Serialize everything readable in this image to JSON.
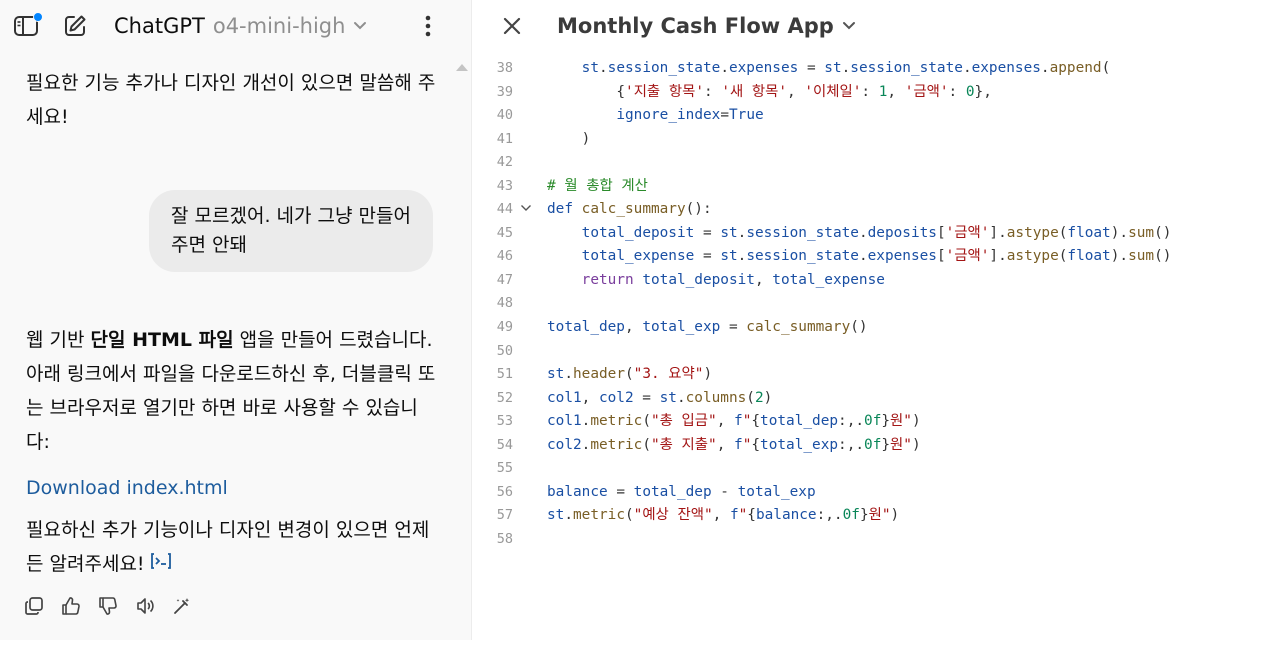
{
  "header": {
    "app_name": "ChatGPT",
    "model_name": "o4-mini-high"
  },
  "chat": {
    "msg1": "필요한 기능 추가나 디자인 개선이 있으면 말씀해 주세요!",
    "user_message": "잘 모르겠어. 네가 그냥 만들어 주면 안돼",
    "msg2_prefix": "웹 기반 ",
    "msg2_bold": "단일 HTML 파일",
    "msg2_suffix": " 앱을 만들어 드렸습니다. 아래 링크에서 파일을 다운로드하신 후, 더블클릭 또는 브라우저로 열기만 하면 바로 사용할 수 있습니다:",
    "download_link": "Download index.html",
    "msg3": "필요하신 추가 기능이나 디자인 변경이 있으면 언제든 알려주세요!"
  },
  "canvas": {
    "title": "Monthly Cash Flow App",
    "lines": [
      {
        "n": "38",
        "indent": 4,
        "fold": false,
        "tokens": [
          [
            "var",
            "st"
          ],
          [
            "p",
            "."
          ],
          [
            "var",
            "session_state"
          ],
          [
            "p",
            "."
          ],
          [
            "var",
            "expenses"
          ],
          [
            "p",
            " = "
          ],
          [
            "var",
            "st"
          ],
          [
            "p",
            "."
          ],
          [
            "var",
            "session_state"
          ],
          [
            "p",
            "."
          ],
          [
            "var",
            "expenses"
          ],
          [
            "p",
            "."
          ],
          [
            "fn",
            "append"
          ],
          [
            "p",
            "("
          ]
        ]
      },
      {
        "n": "39",
        "indent": 8,
        "fold": false,
        "tokens": [
          [
            "p",
            "{"
          ],
          [
            "str",
            "'지출 항목'"
          ],
          [
            "p",
            ": "
          ],
          [
            "str",
            "'새 항목'"
          ],
          [
            "p",
            ", "
          ],
          [
            "str",
            "'이체일'"
          ],
          [
            "p",
            ": "
          ],
          [
            "num",
            "1"
          ],
          [
            "p",
            ", "
          ],
          [
            "str",
            "'금액'"
          ],
          [
            "p",
            ": "
          ],
          [
            "num",
            "0"
          ],
          [
            "p",
            "},"
          ]
        ]
      },
      {
        "n": "40",
        "indent": 8,
        "fold": false,
        "tokens": [
          [
            "var",
            "ignore_index"
          ],
          [
            "p",
            "="
          ],
          [
            "def",
            "True"
          ]
        ]
      },
      {
        "n": "41",
        "indent": 4,
        "fold": false,
        "tokens": [
          [
            "p",
            ")"
          ]
        ]
      },
      {
        "n": "42",
        "indent": 0,
        "fold": false,
        "tokens": []
      },
      {
        "n": "43",
        "indent": 0,
        "fold": false,
        "tokens": [
          [
            "cm",
            "# 월 총합 계산"
          ]
        ]
      },
      {
        "n": "44",
        "indent": 0,
        "fold": true,
        "tokens": [
          [
            "def",
            "def"
          ],
          [
            "p",
            " "
          ],
          [
            "fn",
            "calc_summary"
          ],
          [
            "p",
            "():"
          ]
        ]
      },
      {
        "n": "45",
        "indent": 4,
        "fold": false,
        "tokens": [
          [
            "var",
            "total_deposit"
          ],
          [
            "p",
            " = "
          ],
          [
            "var",
            "st"
          ],
          [
            "p",
            "."
          ],
          [
            "var",
            "session_state"
          ],
          [
            "p",
            "."
          ],
          [
            "var",
            "deposits"
          ],
          [
            "p",
            "["
          ],
          [
            "str",
            "'금액'"
          ],
          [
            "p",
            "]."
          ],
          [
            "fn",
            "astype"
          ],
          [
            "p",
            "("
          ],
          [
            "var",
            "float"
          ],
          [
            "p",
            ")."
          ],
          [
            "fn",
            "sum"
          ],
          [
            "p",
            "()"
          ]
        ]
      },
      {
        "n": "46",
        "indent": 4,
        "fold": false,
        "tokens": [
          [
            "var",
            "total_expense"
          ],
          [
            "p",
            " = "
          ],
          [
            "var",
            "st"
          ],
          [
            "p",
            "."
          ],
          [
            "var",
            "session_state"
          ],
          [
            "p",
            "."
          ],
          [
            "var",
            "expenses"
          ],
          [
            "p",
            "["
          ],
          [
            "str",
            "'금액'"
          ],
          [
            "p",
            "]."
          ],
          [
            "fn",
            "astype"
          ],
          [
            "p",
            "("
          ],
          [
            "var",
            "float"
          ],
          [
            "p",
            ")."
          ],
          [
            "fn",
            "sum"
          ],
          [
            "p",
            "()"
          ]
        ]
      },
      {
        "n": "47",
        "indent": 4,
        "fold": false,
        "tokens": [
          [
            "kw",
            "return"
          ],
          [
            "p",
            " "
          ],
          [
            "var",
            "total_deposit"
          ],
          [
            "p",
            ", "
          ],
          [
            "var",
            "total_expense"
          ]
        ]
      },
      {
        "n": "48",
        "indent": 0,
        "fold": false,
        "tokens": []
      },
      {
        "n": "49",
        "indent": 0,
        "fold": false,
        "tokens": [
          [
            "var",
            "total_dep"
          ],
          [
            "p",
            ", "
          ],
          [
            "var",
            "total_exp"
          ],
          [
            "p",
            " = "
          ],
          [
            "fn",
            "calc_summary"
          ],
          [
            "p",
            "()"
          ]
        ]
      },
      {
        "n": "50",
        "indent": 0,
        "fold": false,
        "tokens": []
      },
      {
        "n": "51",
        "indent": 0,
        "fold": false,
        "tokens": [
          [
            "var",
            "st"
          ],
          [
            "p",
            "."
          ],
          [
            "fn",
            "header"
          ],
          [
            "p",
            "("
          ],
          [
            "str",
            "\"3. 요약\""
          ],
          [
            "p",
            ")"
          ]
        ]
      },
      {
        "n": "52",
        "indent": 0,
        "fold": false,
        "tokens": [
          [
            "var",
            "col1"
          ],
          [
            "p",
            ", "
          ],
          [
            "var",
            "col2"
          ],
          [
            "p",
            " = "
          ],
          [
            "var",
            "st"
          ],
          [
            "p",
            "."
          ],
          [
            "fn",
            "columns"
          ],
          [
            "p",
            "("
          ],
          [
            "num",
            "2"
          ],
          [
            "p",
            ")"
          ]
        ]
      },
      {
        "n": "53",
        "indent": 0,
        "fold": false,
        "tokens": [
          [
            "var",
            "col1"
          ],
          [
            "p",
            "."
          ],
          [
            "fn",
            "metric"
          ],
          [
            "p",
            "("
          ],
          [
            "str",
            "\"총 입금\""
          ],
          [
            "p",
            ", "
          ],
          [
            "def",
            "f"
          ],
          [
            "str",
            "\""
          ],
          [
            "p",
            "{"
          ],
          [
            "var",
            "total_dep"
          ],
          [
            "p",
            ":,."
          ],
          [
            "num",
            "0f"
          ],
          [
            "p",
            "}"
          ],
          [
            "str",
            "원\""
          ],
          [
            "p",
            ")"
          ]
        ]
      },
      {
        "n": "54",
        "indent": 0,
        "fold": false,
        "tokens": [
          [
            "var",
            "col2"
          ],
          [
            "p",
            "."
          ],
          [
            "fn",
            "metric"
          ],
          [
            "p",
            "("
          ],
          [
            "str",
            "\"총 지출\""
          ],
          [
            "p",
            ", "
          ],
          [
            "def",
            "f"
          ],
          [
            "str",
            "\""
          ],
          [
            "p",
            "{"
          ],
          [
            "var",
            "total_exp"
          ],
          [
            "p",
            ":,."
          ],
          [
            "num",
            "0f"
          ],
          [
            "p",
            "}"
          ],
          [
            "str",
            "원\""
          ],
          [
            "p",
            ")"
          ]
        ]
      },
      {
        "n": "55",
        "indent": 0,
        "fold": false,
        "tokens": []
      },
      {
        "n": "56",
        "indent": 0,
        "fold": false,
        "tokens": [
          [
            "var",
            "balance"
          ],
          [
            "p",
            " = "
          ],
          [
            "var",
            "total_dep"
          ],
          [
            "p",
            " - "
          ],
          [
            "var",
            "total_exp"
          ]
        ]
      },
      {
        "n": "57",
        "indent": 0,
        "fold": false,
        "tokens": [
          [
            "var",
            "st"
          ],
          [
            "p",
            "."
          ],
          [
            "fn",
            "metric"
          ],
          [
            "p",
            "("
          ],
          [
            "str",
            "\"예상 잔액\""
          ],
          [
            "p",
            ", "
          ],
          [
            "def",
            "f"
          ],
          [
            "str",
            "\""
          ],
          [
            "p",
            "{"
          ],
          [
            "var",
            "balance"
          ],
          [
            "p",
            ":,."
          ],
          [
            "num",
            "0f"
          ],
          [
            "p",
            "}"
          ],
          [
            "str",
            "원\""
          ],
          [
            "p",
            ")"
          ]
        ]
      },
      {
        "n": "58",
        "indent": 0,
        "fold": false,
        "tokens": []
      }
    ]
  },
  "colors": {
    "badge": "#0285ff",
    "link": "#1d5c9d",
    "bubble": "#ebebeb"
  }
}
